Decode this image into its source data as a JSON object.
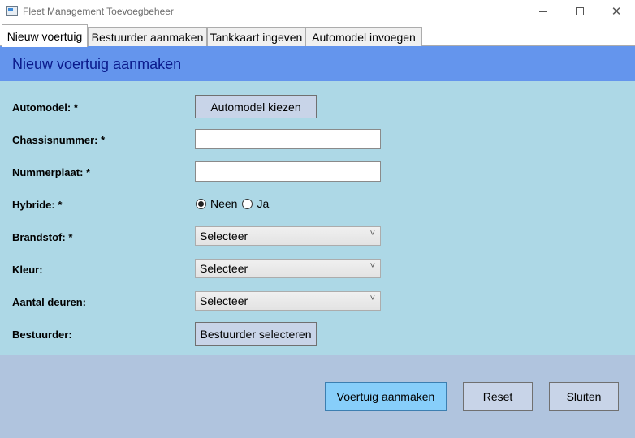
{
  "window": {
    "title": "Fleet Management Toevoegbeheer",
    "app_icon": "window-app-icon"
  },
  "tabs": [
    {
      "label": "Nieuw voertuig",
      "active": true
    },
    {
      "label": "Bestuurder aanmaken",
      "active": false
    },
    {
      "label": "Tankkaart ingeven",
      "active": false
    },
    {
      "label": "Automodel invoegen",
      "active": false
    }
  ],
  "header": {
    "title": "Nieuw voertuig aanmaken",
    "band_color": "#6495ed",
    "title_color": "#0a1a8c"
  },
  "form": {
    "background": "#add8e6",
    "automodel": {
      "label": "Automodel: *",
      "button": "Automodel kiezen"
    },
    "chassisnummer": {
      "label": "Chassisnummer: *",
      "value": ""
    },
    "nummerplaat": {
      "label": "Nummerplaat: *",
      "value": ""
    },
    "hybride": {
      "label": "Hybride: *",
      "options": [
        {
          "label": "Neen",
          "checked": true
        },
        {
          "label": "Ja",
          "checked": false
        }
      ]
    },
    "brandstof": {
      "label": "Brandstof: *",
      "selected": "Selecteer"
    },
    "kleur": {
      "label": "Kleur:",
      "selected": "Selecteer"
    },
    "aantal_deuren": {
      "label": "Aantal deuren:",
      "selected": "Selecteer"
    },
    "bestuurder": {
      "label": "Bestuurder:",
      "button": "Bestuurder selecteren"
    }
  },
  "footer": {
    "background": "#b0c4de",
    "create_label": "Voertuig aanmaken",
    "reset_label": "Reset",
    "close_label": "Sluiten"
  }
}
